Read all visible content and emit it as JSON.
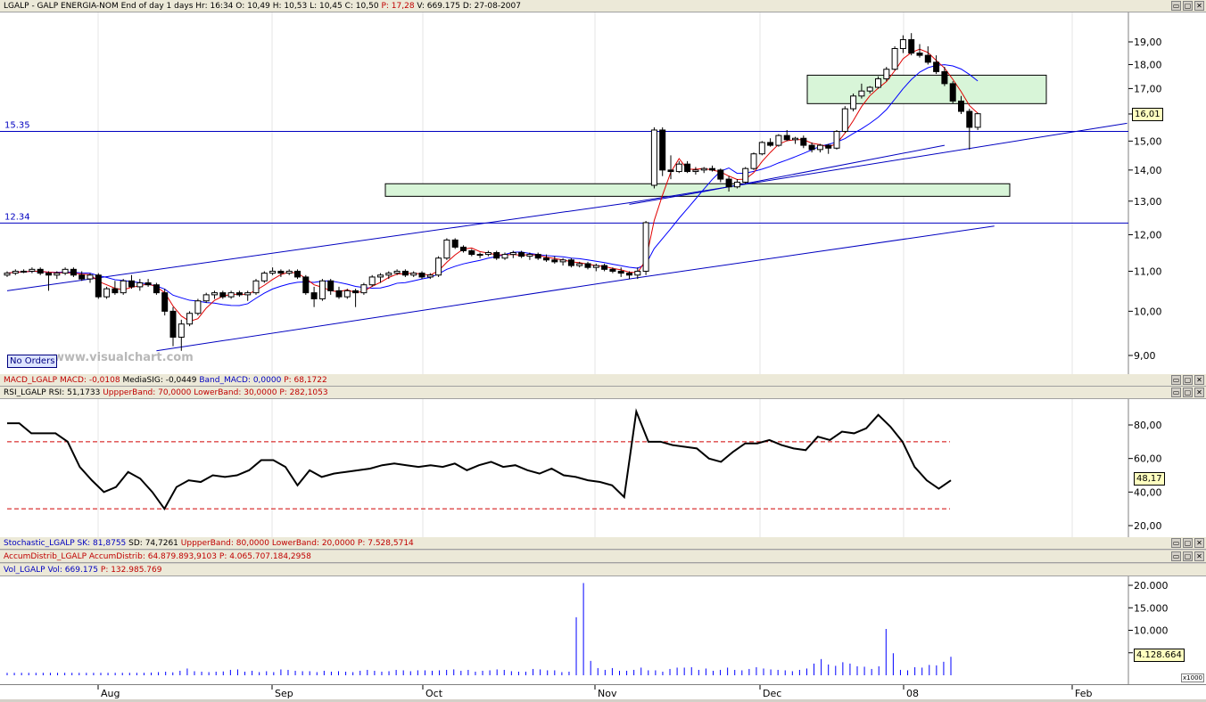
{
  "header": {
    "symbol": "LGALP - GALP ENERGIA-NOM",
    "period": "End of day 1 days",
    "hr": "Hr: 16:34",
    "open": "O: 10,49",
    "high": "H: 10,53",
    "low": "L: 10,45",
    "close": "C: 10,50",
    "p": "P: 17,28",
    "volume": "V: 669.175",
    "date": "D: 27-08-2007"
  },
  "window_buttons": [
    "▭",
    "▢",
    "✕"
  ],
  "price_pane": {
    "y_ticks": [
      "19,00",
      "18,00",
      "17,00",
      "16,00",
      "15,00",
      "14,00",
      "13,00",
      "12,00",
      "11,00",
      "10,00",
      "9,00"
    ],
    "levels": [
      {
        "label": "15.35",
        "value": 15.35
      },
      {
        "label": "12.34",
        "value": 12.34
      }
    ],
    "last_value": "16,01",
    "watermark": "www.visualchart.com",
    "orders_label": "No Orders"
  },
  "macd_bar": {
    "name": "MACD_LGALP",
    "macd": "MACD: -0,0108",
    "sig": "MediaSIG: -0,0449",
    "band": "Band_MACD: 0,0000",
    "p": "P: 68,1722"
  },
  "rsi_bar": {
    "name": "RSI_LGALP",
    "rsi": "RSI: 51,1733",
    "upper": "UppperBand: 70,0000",
    "lower": "LowerBand: 30,0000",
    "p": "P: 282,1053"
  },
  "rsi_pane": {
    "y_ticks": [
      "80,00",
      "60,00",
      "40,00",
      "20,00"
    ],
    "last_value": "48,17",
    "upper_band": 70,
    "lower_band": 30
  },
  "stoch_bar": {
    "name": "Stochastic_LGALP",
    "sk": "SK: 81,8755",
    "sd": "SD: 74,7261",
    "upper": "UppperBand: 80,0000",
    "lower": "LowerBand: 20,0000",
    "p": "P: 7.528,5714"
  },
  "accum_bar": {
    "name": "AccumDistrib_LGALP",
    "ad": "AccumDistrib: 64.879.893,9103",
    "p": "P: 4.065.707.184,2958"
  },
  "vol_bar": {
    "name": "Vol_LGALP",
    "vol": "Vol: 669.175",
    "p": "P: 132.985.769"
  },
  "vol_pane": {
    "y_ticks": [
      "20.000",
      "15.000",
      "10.000",
      "5.000"
    ],
    "last_value": "4.128.664",
    "scale": "x1000"
  },
  "x_axis": {
    "labels": [
      "Aug",
      "Sep",
      "Oct",
      "Nov",
      "Dec",
      "08",
      "Feb"
    ]
  },
  "chart_data": {
    "type": "candlestick",
    "y_scale": "log",
    "price_ylim": [
      8.7,
      19.8
    ],
    "candles": [
      [
        10.9,
        11.0,
        10.85,
        10.95
      ],
      [
        10.95,
        11.05,
        10.9,
        11.0
      ],
      [
        11.0,
        11.05,
        10.95,
        11.0
      ],
      [
        11.0,
        11.1,
        10.95,
        11.05
      ],
      [
        11.05,
        11.1,
        10.9,
        10.95
      ],
      [
        10.95,
        11.0,
        10.5,
        10.9
      ],
      [
        10.9,
        11.0,
        10.8,
        10.95
      ],
      [
        10.95,
        11.1,
        10.9,
        11.05
      ],
      [
        11.05,
        11.1,
        10.85,
        10.9
      ],
      [
        10.9,
        11.0,
        10.75,
        10.8
      ],
      [
        10.8,
        10.95,
        10.7,
        10.9
      ],
      [
        10.9,
        10.95,
        10.3,
        10.35
      ],
      [
        10.35,
        10.6,
        10.3,
        10.55
      ],
      [
        10.55,
        10.75,
        10.4,
        10.45
      ],
      [
        10.45,
        10.8,
        10.4,
        10.75
      ],
      [
        10.75,
        10.9,
        10.55,
        10.6
      ],
      [
        10.6,
        10.8,
        10.5,
        10.7
      ],
      [
        10.7,
        10.8,
        10.6,
        10.65
      ],
      [
        10.65,
        10.7,
        10.4,
        10.45
      ],
      [
        10.45,
        10.55,
        9.9,
        10.0
      ],
      [
        10.0,
        10.1,
        9.2,
        9.4
      ],
      [
        9.4,
        9.8,
        9.1,
        9.7
      ],
      [
        9.7,
        10.0,
        9.65,
        9.95
      ],
      [
        9.95,
        10.3,
        9.9,
        10.25
      ],
      [
        10.25,
        10.45,
        10.2,
        10.4
      ],
      [
        10.4,
        10.5,
        10.3,
        10.45
      ],
      [
        10.45,
        10.5,
        10.3,
        10.35
      ],
      [
        10.35,
        10.5,
        10.3,
        10.45
      ],
      [
        10.45,
        10.5,
        10.35,
        10.4
      ],
      [
        10.4,
        10.5,
        10.25,
        10.45
      ],
      [
        10.45,
        10.8,
        10.4,
        10.75
      ],
      [
        10.75,
        11.0,
        10.7,
        10.95
      ],
      [
        10.95,
        11.1,
        10.9,
        11.0
      ],
      [
        11.0,
        11.05,
        10.85,
        10.95
      ],
      [
        10.95,
        11.05,
        10.9,
        11.0
      ],
      [
        11.0,
        11.05,
        10.8,
        10.85
      ],
      [
        10.85,
        10.9,
        10.4,
        10.45
      ],
      [
        10.45,
        10.6,
        10.1,
        10.3
      ],
      [
        10.3,
        10.8,
        10.25,
        10.75
      ],
      [
        10.75,
        10.8,
        10.4,
        10.5
      ],
      [
        10.5,
        10.6,
        10.3,
        10.35
      ],
      [
        10.35,
        10.55,
        10.3,
        10.5
      ],
      [
        10.5,
        10.55,
        10.1,
        10.45
      ],
      [
        10.45,
        10.7,
        10.4,
        10.65
      ],
      [
        10.65,
        10.9,
        10.6,
        10.85
      ],
      [
        10.85,
        10.95,
        10.7,
        10.9
      ],
      [
        10.9,
        11.0,
        10.8,
        10.95
      ],
      [
        10.95,
        11.05,
        10.9,
        11.0
      ],
      [
        11.0,
        11.05,
        10.85,
        10.9
      ],
      [
        10.9,
        11.0,
        10.85,
        10.95
      ],
      [
        10.95,
        11.0,
        10.8,
        10.85
      ],
      [
        10.85,
        10.95,
        10.8,
        10.9
      ],
      [
        10.9,
        11.4,
        10.85,
        11.35
      ],
      [
        11.35,
        11.9,
        11.3,
        11.85
      ],
      [
        11.85,
        11.9,
        11.6,
        11.65
      ],
      [
        11.65,
        11.7,
        11.5,
        11.55
      ],
      [
        11.55,
        11.6,
        11.4,
        11.45
      ],
      [
        11.45,
        11.5,
        11.35,
        11.45
      ],
      [
        11.45,
        11.55,
        11.4,
        11.5
      ],
      [
        11.5,
        11.55,
        11.3,
        11.35
      ],
      [
        11.35,
        11.5,
        11.3,
        11.45
      ],
      [
        11.45,
        11.55,
        11.35,
        11.5
      ],
      [
        11.5,
        11.55,
        11.35,
        11.4
      ],
      [
        11.4,
        11.5,
        11.3,
        11.45
      ],
      [
        11.45,
        11.5,
        11.3,
        11.35
      ],
      [
        11.35,
        11.45,
        11.25,
        11.3
      ],
      [
        11.3,
        11.4,
        11.2,
        11.25
      ],
      [
        11.25,
        11.35,
        11.15,
        11.3
      ],
      [
        11.3,
        11.35,
        11.1,
        11.15
      ],
      [
        11.15,
        11.25,
        11.1,
        11.2
      ],
      [
        11.2,
        11.25,
        11.05,
        11.1
      ],
      [
        11.1,
        11.2,
        11.0,
        11.15
      ],
      [
        11.15,
        11.2,
        11.0,
        11.05
      ],
      [
        11.05,
        11.1,
        10.95,
        11.0
      ],
      [
        11.0,
        11.1,
        10.85,
        10.95
      ],
      [
        10.95,
        11.0,
        10.8,
        10.9
      ],
      [
        10.9,
        11.1,
        10.8,
        11.0
      ],
      [
        11.0,
        12.4,
        10.9,
        12.35
      ],
      [
        13.5,
        15.5,
        13.4,
        15.4
      ],
      [
        15.4,
        15.5,
        13.8,
        14.0
      ],
      [
        14.0,
        14.5,
        13.7,
        13.95
      ],
      [
        13.95,
        14.3,
        13.9,
        14.2
      ],
      [
        14.2,
        14.3,
        13.9,
        13.95
      ],
      [
        13.95,
        14.1,
        13.85,
        14.0
      ],
      [
        14.0,
        14.1,
        13.9,
        14.05
      ],
      [
        14.05,
        14.15,
        13.95,
        14.0
      ],
      [
        14.0,
        14.05,
        13.6,
        13.7
      ],
      [
        13.7,
        13.8,
        13.3,
        13.45
      ],
      [
        13.45,
        13.7,
        13.4,
        13.6
      ],
      [
        13.6,
        14.1,
        13.55,
        14.05
      ],
      [
        14.05,
        14.6,
        14.0,
        14.55
      ],
      [
        14.55,
        15.0,
        14.5,
        14.95
      ],
      [
        14.95,
        15.1,
        14.8,
        14.85
      ],
      [
        14.85,
        15.25,
        14.8,
        15.2
      ],
      [
        15.2,
        15.4,
        15.0,
        15.05
      ],
      [
        15.05,
        15.15,
        14.9,
        15.1
      ],
      [
        15.1,
        15.2,
        14.75,
        14.85
      ],
      [
        14.85,
        14.95,
        14.6,
        14.7
      ],
      [
        14.7,
        14.9,
        14.6,
        14.85
      ],
      [
        14.85,
        14.9,
        14.55,
        14.75
      ],
      [
        14.75,
        15.4,
        14.7,
        15.35
      ],
      [
        15.35,
        16.3,
        15.3,
        16.2
      ],
      [
        16.2,
        16.8,
        16.1,
        16.7
      ],
      [
        16.7,
        17.2,
        16.6,
        16.9
      ],
      [
        16.9,
        17.1,
        16.8,
        17.05
      ],
      [
        17.05,
        17.5,
        17.0,
        17.4
      ],
      [
        17.4,
        17.9,
        17.3,
        17.8
      ],
      [
        17.8,
        18.8,
        17.75,
        18.7
      ],
      [
        18.7,
        19.3,
        18.5,
        19.1
      ],
      [
        19.1,
        19.4,
        18.4,
        18.5
      ],
      [
        18.5,
        18.9,
        18.3,
        18.4
      ],
      [
        18.4,
        18.8,
        18.0,
        18.1
      ],
      [
        18.1,
        18.4,
        17.6,
        17.7
      ],
      [
        17.7,
        17.9,
        17.1,
        17.2
      ],
      [
        17.2,
        17.3,
        16.4,
        16.5
      ],
      [
        16.5,
        16.7,
        16.0,
        16.1
      ],
      [
        16.1,
        16.2,
        14.7,
        15.5
      ],
      [
        15.5,
        16.05,
        15.4,
        16.01
      ]
    ],
    "rsi": [
      81,
      81,
      75,
      75,
      75,
      70,
      55,
      47,
      40,
      43,
      52,
      48,
      40,
      30,
      43,
      47,
      46,
      50,
      49,
      50,
      53,
      59,
      59,
      55,
      44,
      53,
      49,
      51,
      52,
      53,
      54,
      56,
      57,
      56,
      55,
      56,
      55,
      57,
      53,
      56,
      58,
      55,
      56,
      53,
      51,
      54,
      50,
      49,
      47,
      46,
      44,
      37,
      88,
      70,
      70,
      68,
      67,
      66,
      60,
      58,
      64,
      69,
      69,
      71,
      68,
      66,
      65,
      73,
      71,
      76,
      75,
      78,
      86,
      79,
      70,
      55,
      47,
      42,
      47
    ],
    "ma_fast_is_red": true,
    "volume_k": [
      550,
      550,
      550,
      550,
      550,
      550,
      550,
      550,
      550,
      550,
      550,
      550,
      550,
      550,
      550,
      550,
      550,
      550,
      550,
      550,
      600,
      700,
      800,
      650,
      1000,
      1500,
      900,
      800,
      700,
      800,
      850,
      1200,
      1300,
      800,
      1000,
      700,
      900,
      700,
      1300,
      1200,
      1000,
      900,
      900,
      700,
      1000,
      800,
      900,
      800,
      700,
      1000,
      1200,
      1000,
      800,
      900,
      1200,
      1100,
      900,
      1100,
      1100,
      1000,
      1100,
      1200,
      1300,
      1000,
      1200,
      800,
      1000,
      1100,
      1300,
      1200,
      900,
      800,
      800,
      1400,
      1300,
      1100,
      1100,
      700,
      800,
      12900,
      20500,
      3200,
      1600,
      1200,
      1600,
      1000,
      1000,
      1200,
      1700,
      1100,
      1100,
      800,
      1400,
      1700,
      1700,
      1800,
      1200,
      1500,
      1000,
      1200,
      1700,
      1200,
      1100,
      1400,
      1800,
      1500,
      1300,
      1200,
      1100,
      900,
      1200,
      1500,
      2600,
      3600,
      2400,
      2100,
      2900,
      2600,
      2000,
      1900,
      1400,
      2000,
      10300,
      4900,
      1200,
      1100,
      1800,
      1700,
      2300,
      2200,
      3000,
      4100
    ],
    "y_ticks_rsi": [
      80,
      60,
      40,
      20
    ],
    "y_ticks_volume_k": [
      20000,
      15000,
      10000,
      5000
    ]
  }
}
